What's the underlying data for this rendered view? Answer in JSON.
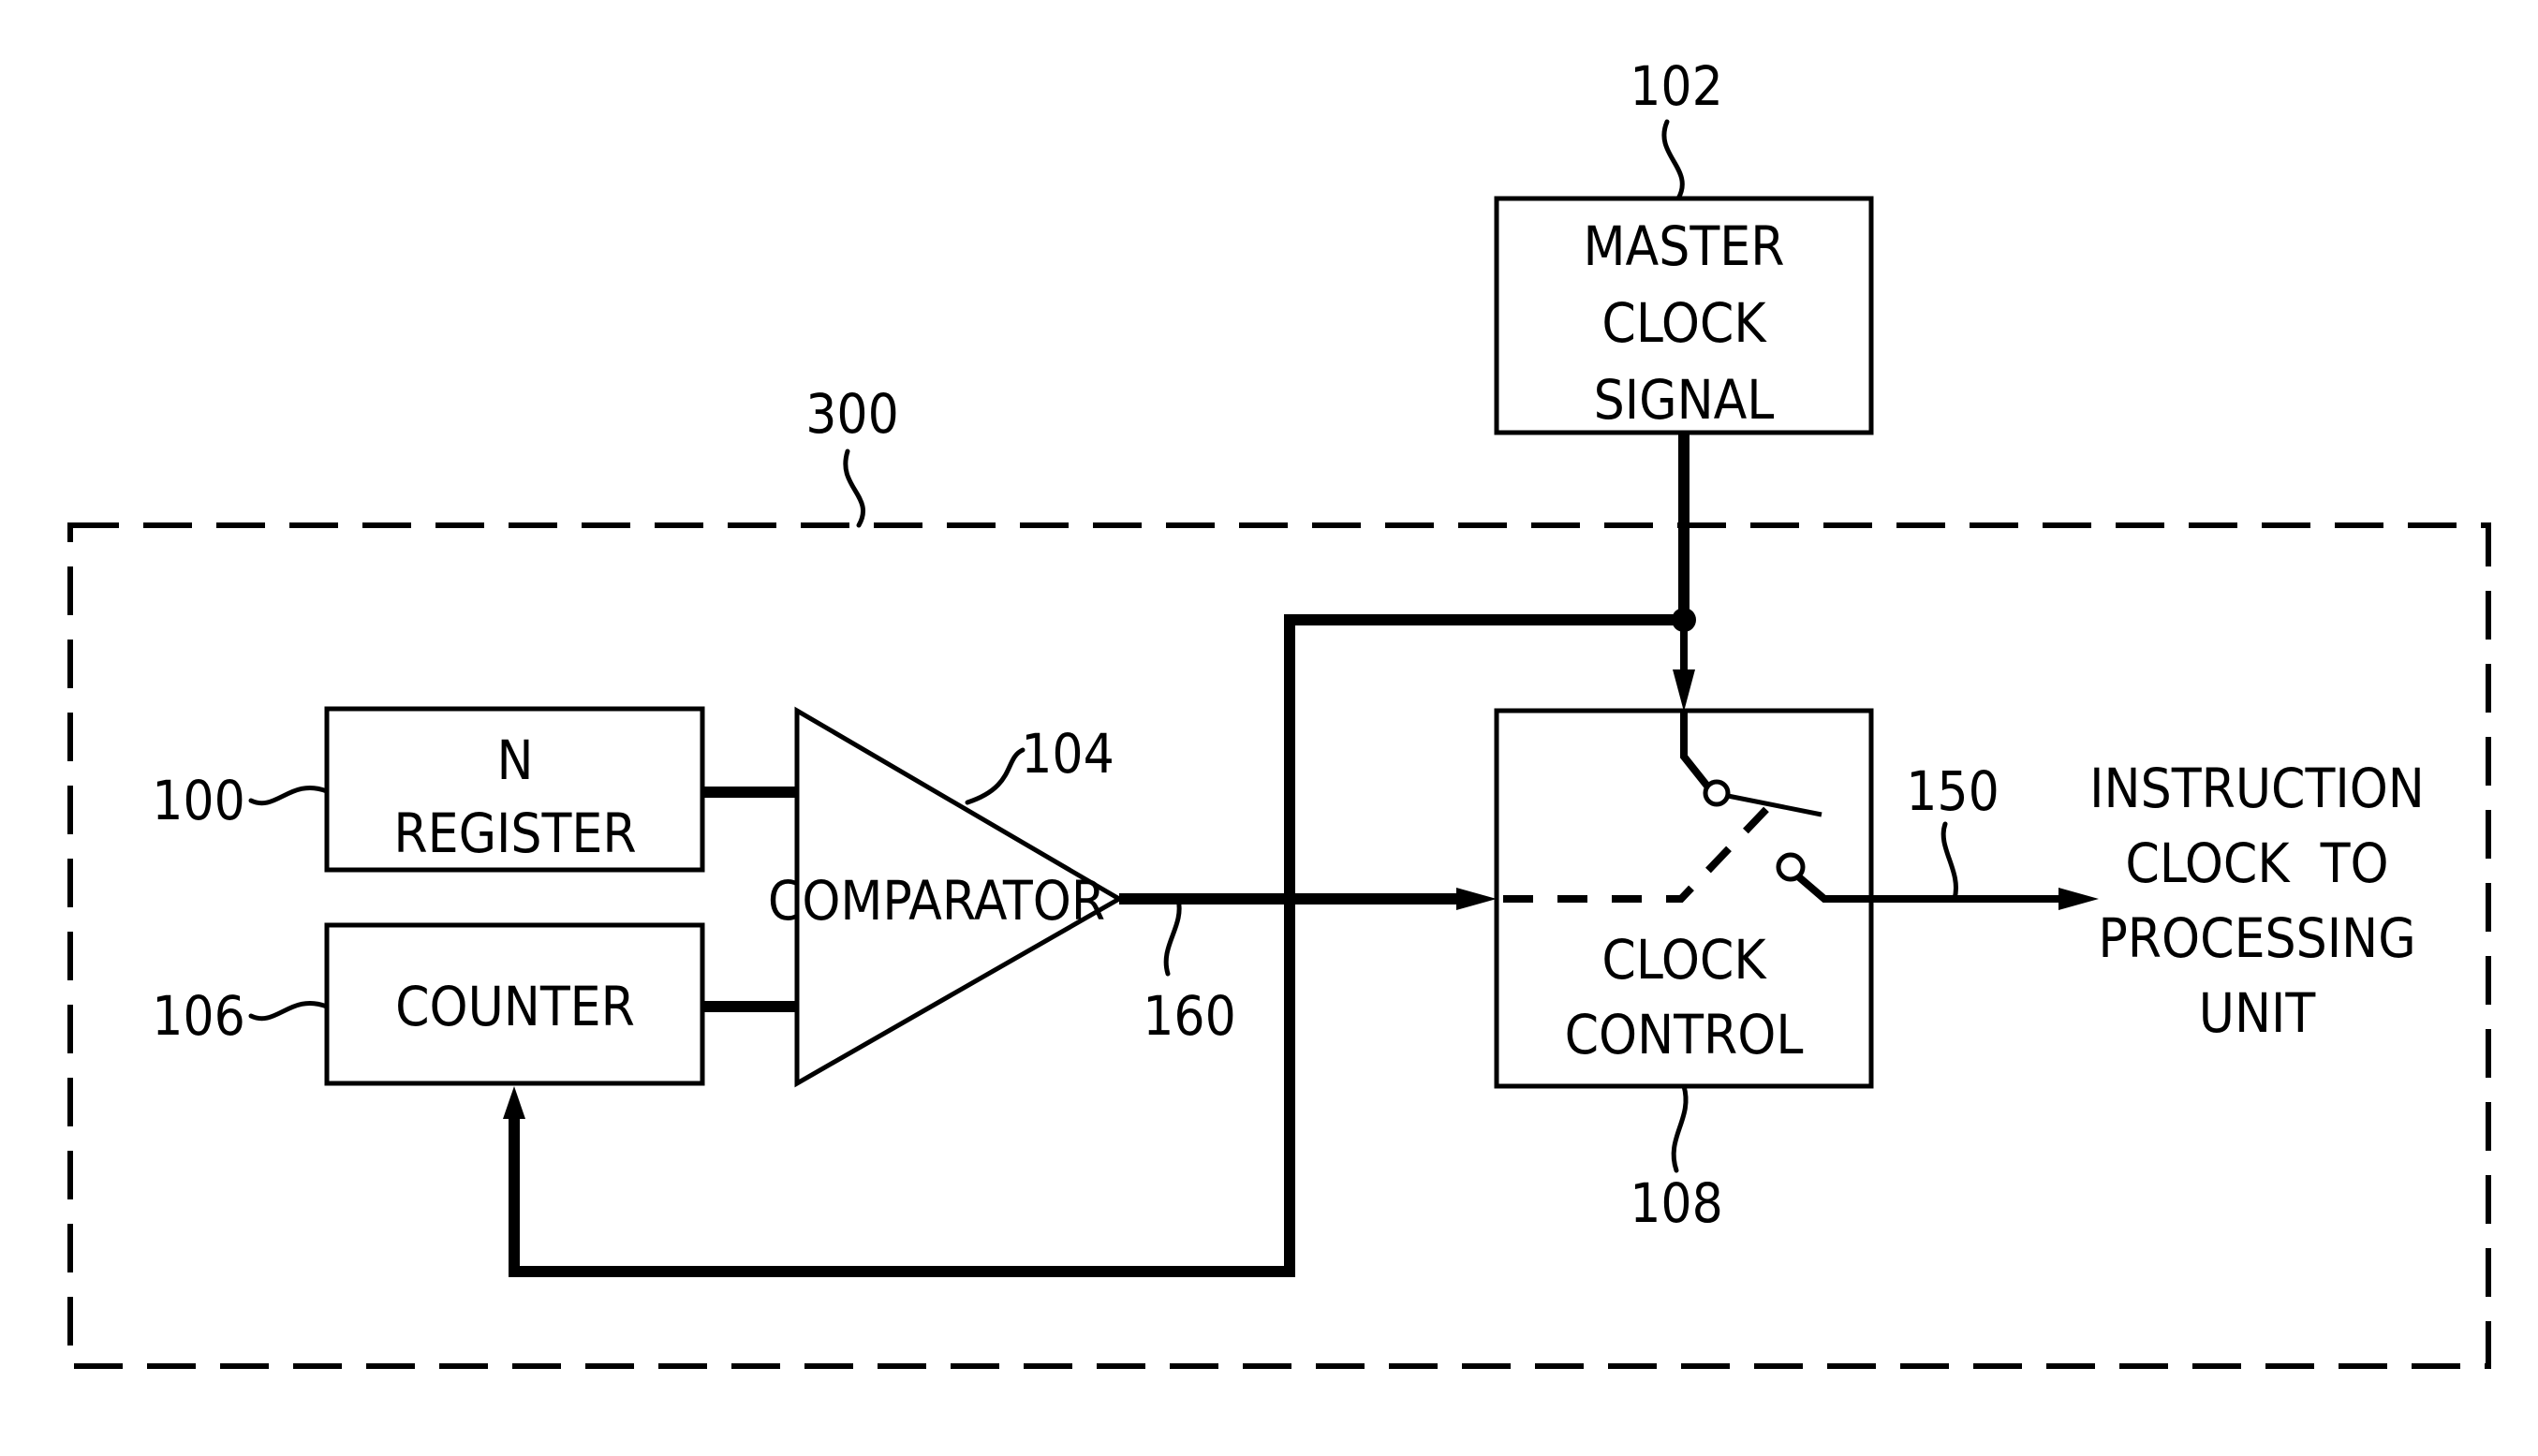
{
  "figure": {
    "type": "block-diagram",
    "boundary": {
      "ref": "300"
    },
    "blocks": {
      "master_clock": {
        "ref": "102",
        "lines": [
          "MASTER",
          "CLOCK",
          "SIGNAL"
        ]
      },
      "n_register": {
        "ref": "100",
        "lines": [
          "N",
          "REGISTER"
        ]
      },
      "counter": {
        "ref": "106",
        "lines": [
          "COUNTER"
        ]
      },
      "comparator": {
        "ref": "104",
        "lines": [
          "COMPARATOR"
        ]
      },
      "clock_control": {
        "ref": "108",
        "lines": [
          "CLOCK",
          "CONTROL"
        ]
      }
    },
    "signals": {
      "comparator_output": {
        "ref": "160"
      },
      "instruction_clock": {
        "ref": "150"
      }
    },
    "output_label": {
      "lines": [
        "INSTRUCTION",
        "CLOCK  TO",
        "PROCESSING",
        "UNIT"
      ]
    },
    "connections": [
      {
        "from": "master_clock",
        "to": "clock_control",
        "kind": "arrow"
      },
      {
        "from": "master_clock",
        "to": "counter",
        "kind": "feedback-arrow"
      },
      {
        "from": "n_register",
        "to": "comparator",
        "kind": "line"
      },
      {
        "from": "counter",
        "to": "comparator",
        "kind": "line"
      },
      {
        "from": "comparator",
        "to": "clock_control",
        "kind": "arrow"
      },
      {
        "from": "clock_control",
        "to": "output",
        "kind": "arrow"
      }
    ]
  }
}
